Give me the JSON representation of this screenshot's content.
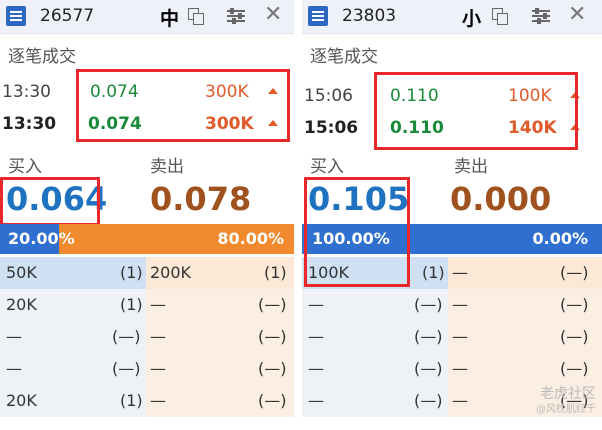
{
  "colors": {
    "green": "#1a8a3a",
    "orange": "#e05a2a",
    "blue_price": "#1f72c0",
    "brown_price": "#a0521e",
    "buy_bar": "#2f6fd0",
    "sell_bar": "#f08a2c",
    "highlight": "#e8272a"
  },
  "panels": [
    {
      "code": "26577",
      "badge": "中",
      "title": "逐笔成交",
      "trades": [
        {
          "time": "13:30",
          "price": "0.074",
          "vol": "300K"
        },
        {
          "time": "13:30",
          "price": "0.074",
          "vol": "300K"
        }
      ],
      "buy_label": "买入",
      "sell_label": "卖出",
      "buy_price": "0.064",
      "sell_price": "0.078",
      "buy_pct": "20.00%",
      "sell_pct": "80.00%",
      "buy_fraction": 0.2,
      "book": [
        {
          "bv": "50K",
          "bc": "(1)",
          "sv": "200K",
          "sc": "(1)"
        },
        {
          "bv": "20K",
          "bc": "(1)",
          "sv": "—",
          "sc": "(—)"
        },
        {
          "bv": "—",
          "bc": "(—)",
          "sv": "—",
          "sc": "(—)"
        },
        {
          "bv": "—",
          "bc": "(—)",
          "sv": "—",
          "sc": "(—)"
        },
        {
          "bv": "20K",
          "bc": "(1)",
          "sv": "—",
          "sc": "(—)"
        }
      ]
    },
    {
      "code": "23803",
      "badge": "小",
      "title": "逐笔成交",
      "trades": [
        {
          "time": "15:06",
          "price": "0.110",
          "vol": "100K"
        },
        {
          "time": "15:06",
          "price": "0.110",
          "vol": "140K"
        }
      ],
      "buy_label": "买入",
      "sell_label": "卖出",
      "buy_price": "0.105",
      "sell_price": "0.000",
      "buy_pct": "100.00%",
      "sell_pct": "0.00%",
      "buy_fraction": 1.0,
      "book": [
        {
          "bv": "100K",
          "bc": "(1)",
          "sv": "—",
          "sc": "(—)"
        },
        {
          "bv": "—",
          "bc": "(—)",
          "sv": "—",
          "sc": "(—)"
        },
        {
          "bv": "—",
          "bc": "(—)",
          "sv": "—",
          "sc": "(—)"
        },
        {
          "bv": "—",
          "bc": "(—)",
          "sv": "—",
          "sc": "(—)"
        },
        {
          "bv": "—",
          "bc": "(—)",
          "sv": "—",
          "sc": "(—)"
        }
      ]
    }
  ],
  "watermark": {
    "line1": "老虎社区",
    "line2": "@风枕肌红千"
  }
}
